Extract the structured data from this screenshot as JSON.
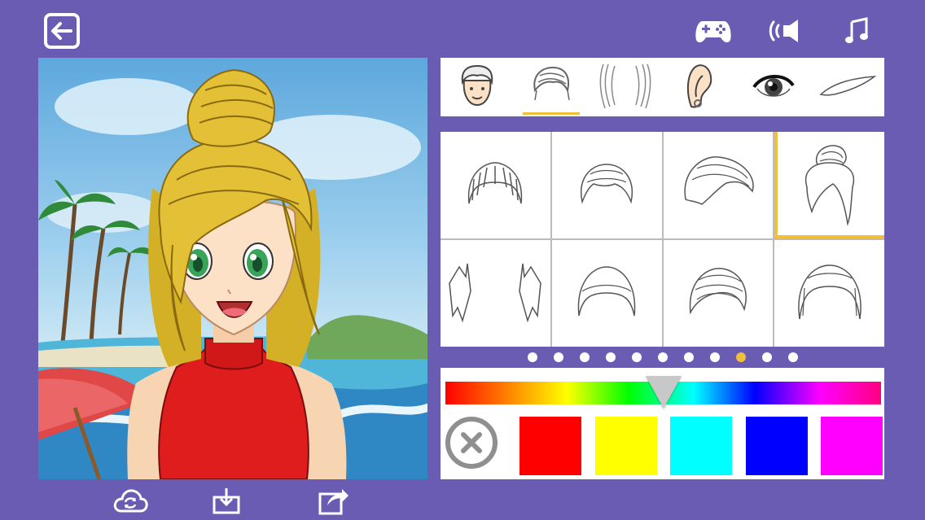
{
  "toolbar": {
    "exit_icon": "exit-icon",
    "gamepad_icon": "gamepad-icon",
    "sound_icon": "sound-icon",
    "music_icon": "music-icon"
  },
  "categories": [
    {
      "name": "face",
      "icon": "face-icon"
    },
    {
      "name": "front-hair",
      "icon": "front-hair-icon",
      "active": true
    },
    {
      "name": "back-hair",
      "icon": "back-hair-icon"
    },
    {
      "name": "ear",
      "icon": "ear-icon"
    },
    {
      "name": "eye",
      "icon": "eye-icon"
    },
    {
      "name": "eyebrow",
      "icon": "eyebrow-icon"
    }
  ],
  "hair_options": [
    {
      "name": "hair-style-1",
      "selected": false
    },
    {
      "name": "hair-style-2",
      "selected": false
    },
    {
      "name": "hair-style-3",
      "selected": false
    },
    {
      "name": "hair-style-4",
      "selected": true
    },
    {
      "name": "hair-style-5",
      "selected": false
    },
    {
      "name": "hair-style-6",
      "selected": false
    },
    {
      "name": "hair-style-7",
      "selected": false
    },
    {
      "name": "hair-style-8",
      "selected": false
    }
  ],
  "pagination": {
    "pages": 11,
    "current": 9
  },
  "color_picker": {
    "hue_position": 0.5,
    "swatches": [
      "#ff0000",
      "#ffff00",
      "#00ffff",
      "#0000ff",
      "#ff00ff"
    ]
  },
  "colors": {
    "background": "#6a5bb3",
    "accent": "#f0bf3c",
    "hair": "#e3c035",
    "eyes": "#3aa35a",
    "outfit": "#e01d1d"
  },
  "bottom_bar": {
    "icons": [
      "cloud-sync-icon",
      "download-icon",
      "share-icon"
    ]
  }
}
